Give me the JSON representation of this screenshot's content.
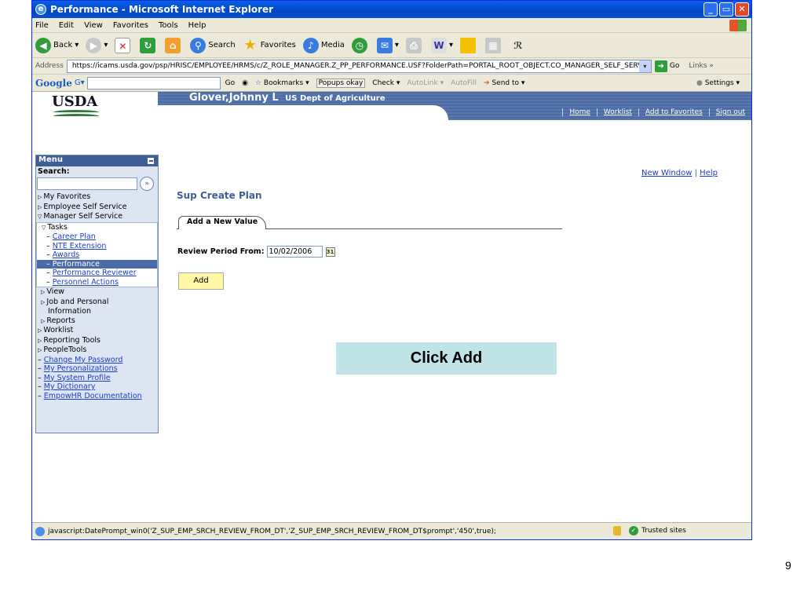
{
  "window": {
    "title": "Performance - Microsoft Internet Explorer",
    "buttons": {
      "minimize": "_",
      "maximize": "▭",
      "close": "✕"
    }
  },
  "menubar": [
    "File",
    "Edit",
    "View",
    "Favorites",
    "Tools",
    "Help"
  ],
  "toolbar": {
    "back": "Back",
    "search": "Search",
    "favorites": "Favorites",
    "media": "Media"
  },
  "addressbar": {
    "label": "Address",
    "url": "https://icams.usda.gov/psp/HRISC/EMPLOYEE/HRMS/c/Z_ROLE_MANAGER.Z_PP_PERFORMANCE.USF?FolderPath=PORTAL_ROOT_OBJECT.CO_MANAGER_SELF_SERVICE",
    "go": "Go",
    "links": "Links »"
  },
  "googlebar": {
    "logo": "Google",
    "go": "Go",
    "bookmarks": "Bookmarks ▾",
    "popups": "Popups okay",
    "check": "Check ▾",
    "autolink": "AutoLink ▾",
    "autofill": "AutoFill",
    "sendto": "Send to ▾",
    "settings": "Settings ▾"
  },
  "header": {
    "logo": "USDA",
    "user": "Glover,Johnny L",
    "dept": "US Dept of Agriculture",
    "nav": [
      "Home",
      "Worklist",
      "Add to Favorites",
      "Sign out"
    ]
  },
  "sidebar": {
    "title": "Menu",
    "search_label": "Search:",
    "search_go": "»",
    "items": [
      {
        "label": "My Favorites",
        "level": 0,
        "type": "folder"
      },
      {
        "label": "Employee Self Service",
        "level": 0,
        "type": "folder"
      },
      {
        "label": "Manager Self Service",
        "level": 0,
        "type": "open"
      }
    ],
    "tasks_label": "Tasks",
    "tasks": [
      "Career Plan",
      "NTE Extension",
      "Awards",
      "Performance",
      "Performance Reviewer",
      "Personnel Actions"
    ],
    "selected_task": "Performance",
    "sub_items": [
      "View",
      "Job and Personal",
      "Information",
      "Reports"
    ],
    "bottom_items": [
      "Worklist",
      "Reporting Tools",
      "PeopleTools"
    ],
    "bottom_links": [
      "Change My Password",
      "My Personalizations",
      "My System Profile",
      "My Dictionary",
      "EmpowHR Documentation"
    ]
  },
  "main": {
    "new_window": "New Window",
    "help": "Help",
    "page_title": "Sup Create Plan",
    "tab": "Add a New Value",
    "review_label": "Review Period From:",
    "review_value": "10/02/2006",
    "add_button": "Add",
    "callout": "Click Add"
  },
  "statusbar": {
    "text": "javascript:DatePrompt_win0('Z_SUP_EMP_SRCH_REVIEW_FROM_DT','Z_SUP_EMP_SRCH_REVIEW_FROM_DT$prompt','450',true);",
    "zone": "Trusted sites"
  },
  "slide_number": "9"
}
